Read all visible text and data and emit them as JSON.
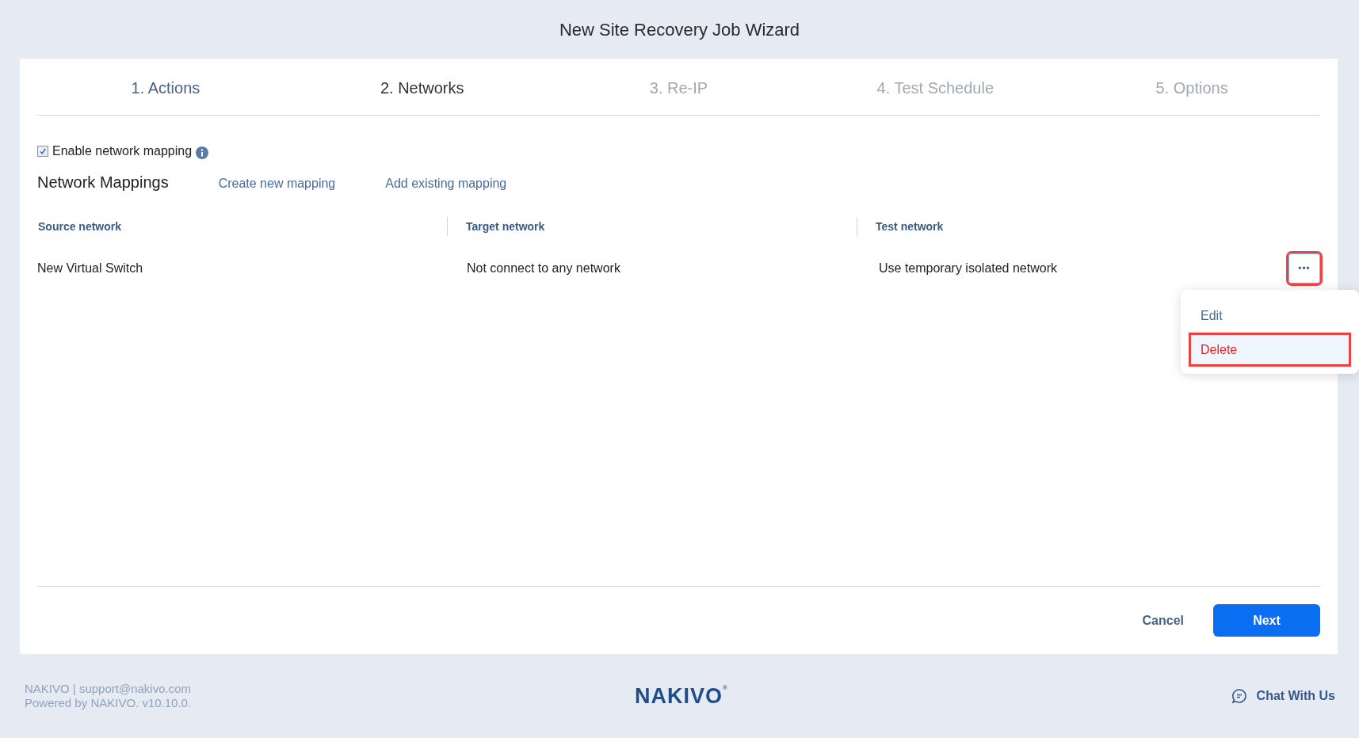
{
  "window": {
    "title": "New Site Recovery Job Wizard"
  },
  "steps": [
    {
      "label": "1. Actions",
      "completed": true,
      "selected": false
    },
    {
      "label": "2. Networks",
      "completed": false,
      "selected": true
    },
    {
      "label": "3. Re-IP",
      "completed": false,
      "selected": false
    },
    {
      "label": "4. Test Schedule",
      "completed": false,
      "selected": false
    },
    {
      "label": "5. Options",
      "completed": false,
      "selected": false
    }
  ],
  "enable_mapping": {
    "label": "Enable network mapping",
    "checked": true
  },
  "mappings": {
    "title": "Network Mappings",
    "links": [
      "Create new mapping",
      "Add existing mapping"
    ],
    "columns": [
      "Source network",
      "Target network",
      "Test network"
    ],
    "rows": [
      {
        "cells": [
          "New Virtual Switch",
          "Not connect to any network",
          "Use temporary isolated network"
        ],
        "menu_button": {
          "label": "•••",
          "highlighted": true
        }
      }
    ]
  },
  "menu": {
    "items": [
      {
        "label": "Edit",
        "kind": "normal",
        "highlighted": false
      },
      {
        "label": "Delete",
        "kind": "danger",
        "highlighted": true
      }
    ]
  },
  "buttons": [
    {
      "label": "Cancel",
      "kind": "secondary"
    },
    {
      "label": "Next",
      "kind": "primary"
    }
  ],
  "footer": {
    "lines": [
      "NAKIVO | support@nakivo.com",
      "Powered by NAKIVO. v10.10.0."
    ],
    "logo": "NAKIVO",
    "logo_mark": "®",
    "chat": "Chat With Us"
  }
}
